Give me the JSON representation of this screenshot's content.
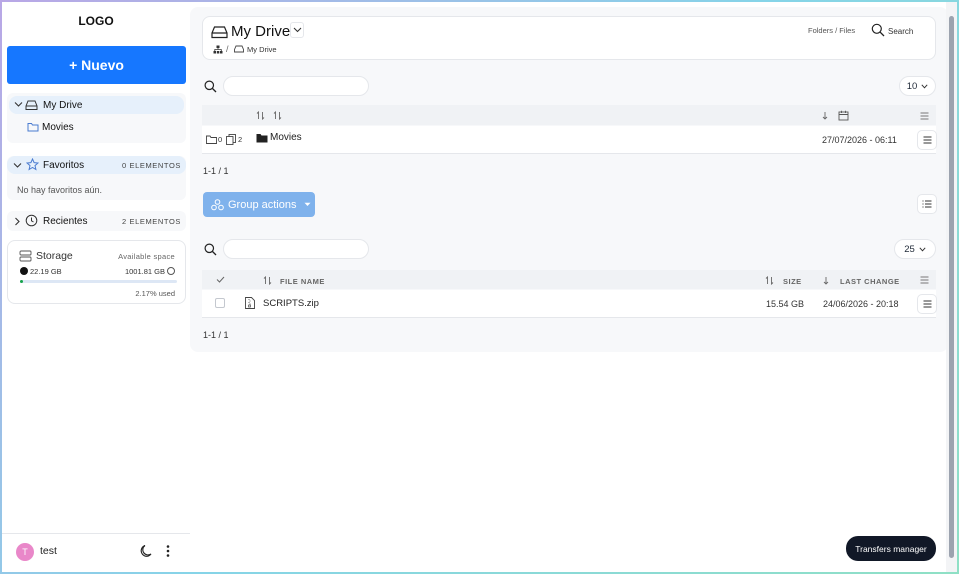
{
  "sidebar": {
    "logo": "LOGO",
    "new_button": "+ Nuevo",
    "tree": [
      {
        "label": "My Drive",
        "icon": "drive-icon"
      },
      {
        "label": "Movies",
        "icon": "folder-icon"
      }
    ],
    "favorites": {
      "label": "Favoritos",
      "count": "0 ELEMENTOS",
      "empty": "No hay favoritos aún."
    },
    "recents": {
      "label": "Recientes",
      "count": "2 ELEMENTOS"
    },
    "storage": {
      "title": "Storage",
      "available_label": "Available space",
      "used": "22.19 GB",
      "total": "1001.81 GB",
      "percent_text": "2.17% used",
      "percent": 2.17
    },
    "user": {
      "initial": "T",
      "name": "test"
    }
  },
  "header": {
    "title": "My Drive",
    "toggle_label": "Folders / Files",
    "search_label": "Search",
    "breadcrumb": [
      "/",
      "My Drive"
    ]
  },
  "folders": {
    "page_size": "10",
    "rows": [
      {
        "folders": "0",
        "files": "2",
        "name": "Movies",
        "date": "27/07/2026 - 06:11"
      }
    ],
    "pagination": "1-1 / 1"
  },
  "files": {
    "group_actions": "Group actions",
    "page_size": "25",
    "columns": {
      "name": "FILE NAME",
      "size": "SIZE",
      "last_change": "LAST CHANGE"
    },
    "rows": [
      {
        "name": "SCRIPTS.zip",
        "size": "15.54 GB",
        "last_change": "24/06/2026 - 20:18"
      }
    ],
    "pagination": "1-1 / 1"
  },
  "transfers_button": "Transfers manager",
  "colors": {
    "primary": "#1677ff",
    "group_actions": "#7fb2ec",
    "avatar": "#e987c9"
  }
}
